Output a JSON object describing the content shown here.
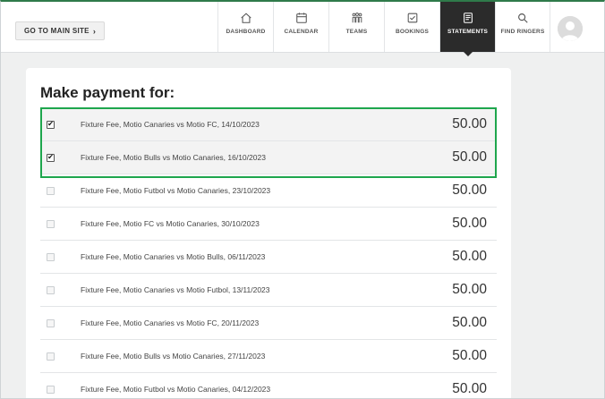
{
  "topbar": {
    "main_site_label": "GO TO MAIN SITE",
    "nav": [
      {
        "label": "DASHBOARD",
        "icon": "house-icon"
      },
      {
        "label": "CALENDAR",
        "icon": "calendar-icon"
      },
      {
        "label": "TEAMS",
        "icon": "teams-icon"
      },
      {
        "label": "BOOKINGS",
        "icon": "bookings-icon"
      },
      {
        "label": "STATEMENTS",
        "icon": "statements-icon",
        "active": true
      },
      {
        "label": "FIND RINGERS",
        "icon": "search-icon"
      }
    ]
  },
  "card": {
    "title": "Make payment for:",
    "rows": [
      {
        "label": "Fixture Fee, Motio Canaries vs Motio FC, 14/10/2023",
        "amount": "50.00",
        "checked": true
      },
      {
        "label": "Fixture Fee, Motio Bulls vs Motio Canaries, 16/10/2023",
        "amount": "50.00",
        "checked": true
      },
      {
        "label": "Fixture Fee, Motio Futbol vs Motio Canaries, 23/10/2023",
        "amount": "50.00",
        "checked": false
      },
      {
        "label": "Fixture Fee, Motio FC vs Motio Canaries, 30/10/2023",
        "amount": "50.00",
        "checked": false
      },
      {
        "label": "Fixture Fee, Motio Canaries vs Motio Bulls, 06/11/2023",
        "amount": "50.00",
        "checked": false
      },
      {
        "label": "Fixture Fee, Motio Canaries vs Motio Futbol, 13/11/2023",
        "amount": "50.00",
        "checked": false
      },
      {
        "label": "Fixture Fee, Motio Canaries vs Motio FC, 20/11/2023",
        "amount": "50.00",
        "checked": false
      },
      {
        "label": "Fixture Fee, Motio Bulls vs Motio Canaries, 27/11/2023",
        "amount": "50.00",
        "checked": false
      },
      {
        "label": "Fixture Fee, Motio Futbol vs Motio Canaries, 04/12/2023",
        "amount": "50.00",
        "checked": false
      }
    ]
  },
  "colors": {
    "highlight": "#1ea64d",
    "active_nav": "#2b2b2b"
  }
}
